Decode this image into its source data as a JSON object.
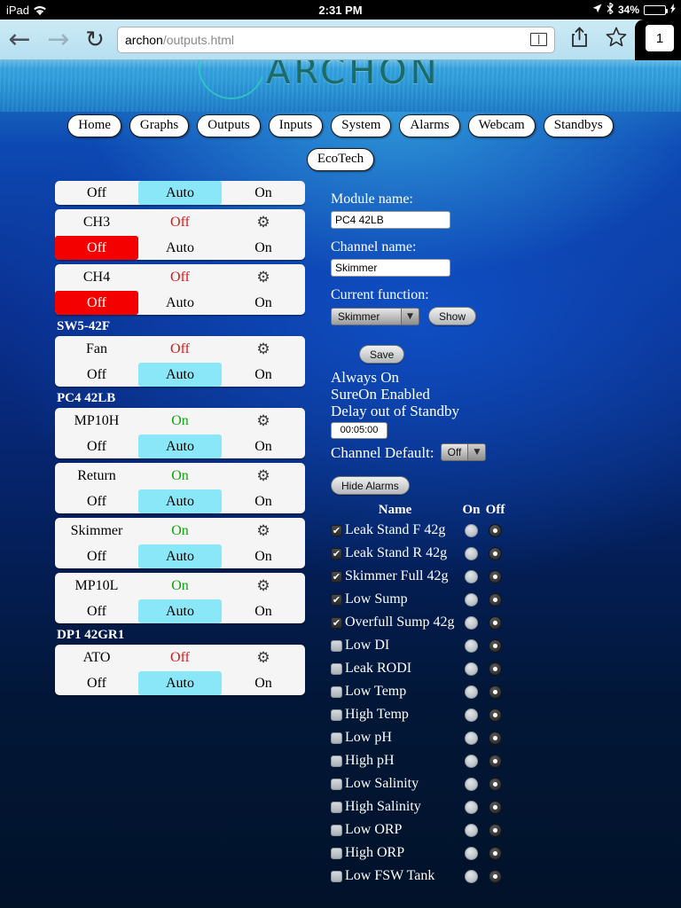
{
  "statusbar": {
    "device": "iPad",
    "wifi_icon": "wifi-icon",
    "time": "2:31 PM",
    "location_icon": "location-arrow-icon",
    "bluetooth_icon": "bluetooth-icon",
    "battery_percent": "34%",
    "battery_fill_color": "#4cd964"
  },
  "browser": {
    "back_icon": "back-arrow-icon",
    "forward_icon": "forward-arrow-icon",
    "reload_icon": "reload-icon",
    "url_host": "archon",
    "url_path": "/outputs.html",
    "reader_icon": "reader-view-icon",
    "share_icon": "share-icon",
    "bookmark_icon": "bookmark-star-icon",
    "tab_count": "1"
  },
  "site": {
    "logo_text": "ARCHON",
    "nav_row1": [
      {
        "label": "Home"
      },
      {
        "label": "Graphs"
      },
      {
        "label": "Outputs"
      },
      {
        "label": "Inputs"
      },
      {
        "label": "System"
      },
      {
        "label": "Alarms"
      },
      {
        "label": "Webcam"
      },
      {
        "label": "Standbys"
      }
    ],
    "nav_row2": [
      {
        "label": "EcoTech"
      }
    ]
  },
  "outputs": {
    "btn_off": "Off",
    "btn_auto": "Auto",
    "btn_on": "On",
    "gear_icon": "gear-icon",
    "items": [
      {
        "kind": "card",
        "partial_top": true,
        "name": "",
        "state": "",
        "state_class": "",
        "selected": "auto"
      },
      {
        "kind": "card",
        "name": "CH3",
        "state": "Off",
        "state_class": "off",
        "selected": "off"
      },
      {
        "kind": "card",
        "name": "CH4",
        "state": "Off",
        "state_class": "off",
        "selected": "off"
      },
      {
        "kind": "group",
        "label": "SW5-42F"
      },
      {
        "kind": "card",
        "name": "Fan",
        "state": "Off",
        "state_class": "off",
        "selected": "auto"
      },
      {
        "kind": "group",
        "label": "PC4 42LB"
      },
      {
        "kind": "card",
        "name": "MP10H",
        "state": "On",
        "state_class": "on",
        "selected": "auto"
      },
      {
        "kind": "card",
        "name": "Return",
        "state": "On",
        "state_class": "on",
        "selected": "auto"
      },
      {
        "kind": "card",
        "name": "Skimmer",
        "state": "On",
        "state_class": "on",
        "selected": "auto"
      },
      {
        "kind": "card",
        "name": "MP10L",
        "state": "On",
        "state_class": "on",
        "selected": "auto"
      },
      {
        "kind": "group",
        "label": "DP1 42GR1"
      },
      {
        "kind": "card",
        "name": "ATO",
        "state": "Off",
        "state_class": "off",
        "selected": "auto"
      }
    ]
  },
  "detail": {
    "module_label": "Module name:",
    "module_value": "PC4 42LB",
    "channel_label": "Channel name:",
    "channel_value": "Skimmer",
    "function_label": "Current function:",
    "function_value": "Skimmer",
    "dropdown_icon": "chevron-down-icon",
    "show_button": "Show",
    "save_button": "Save",
    "always_on": "Always On",
    "sureon_enabled": "SureOn Enabled",
    "delay_label": "Delay out of Standby",
    "delay_value": "00:05:00",
    "channel_default_label": "Channel Default:",
    "channel_default_value": "Off"
  },
  "alarms": {
    "toggle_button": "Hide Alarms",
    "header_name": "Name",
    "header_on": "On",
    "header_off": "Off",
    "check_glyph": "✔",
    "rows": [
      {
        "name": "Leak Stand F 42g",
        "checked": true,
        "mode": "off"
      },
      {
        "name": "Leak Stand R 42g",
        "checked": true,
        "mode": "off"
      },
      {
        "name": "Skimmer Full 42g",
        "checked": true,
        "mode": "off"
      },
      {
        "name": "Low Sump",
        "checked": true,
        "mode": "off"
      },
      {
        "name": "Overfull Sump 42g",
        "checked": true,
        "mode": "off"
      },
      {
        "name": "Low DI",
        "checked": false,
        "mode": "off"
      },
      {
        "name": "Leak RODI",
        "checked": false,
        "mode": "off"
      },
      {
        "name": "Low Temp",
        "checked": false,
        "mode": "off"
      },
      {
        "name": "High Temp",
        "checked": false,
        "mode": "off"
      },
      {
        "name": "Low pH",
        "checked": false,
        "mode": "off"
      },
      {
        "name": "High pH",
        "checked": false,
        "mode": "off"
      },
      {
        "name": "Low Salinity",
        "checked": false,
        "mode": "off"
      },
      {
        "name": "High Salinity",
        "checked": false,
        "mode": "off"
      },
      {
        "name": "Low ORP",
        "checked": false,
        "mode": "off"
      },
      {
        "name": "High ORP",
        "checked": false,
        "mode": "off"
      },
      {
        "name": "Low FSW Tank",
        "checked": false,
        "mode": "off"
      }
    ]
  }
}
